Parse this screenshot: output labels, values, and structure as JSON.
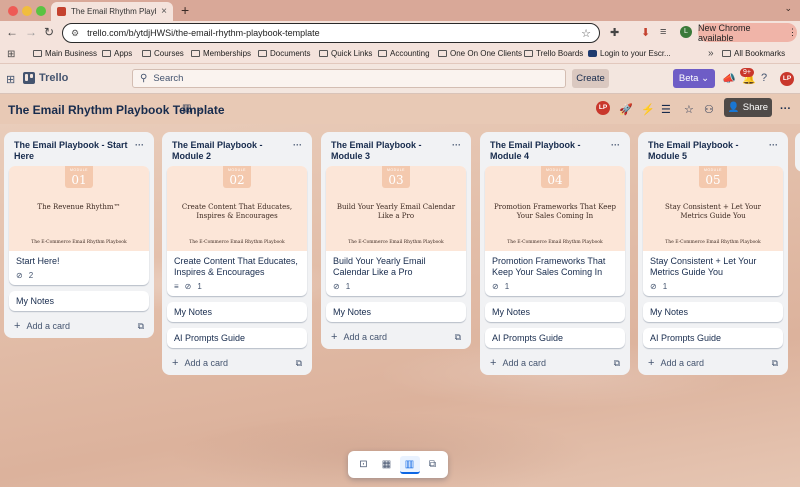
{
  "browser": {
    "tab_title": "The Email Rhythm Playbook T",
    "tab_close": "×",
    "new_tab": "+",
    "url": "trello.com/b/ytdjHWSi/the-email-rhythm-playbook-template",
    "new_chrome": "New Chrome available",
    "new_chrome_more": "⋮",
    "profile_initial": "L",
    "bookmarks": [
      "Main Business",
      "Apps",
      "Courses",
      "Memberships",
      "Documents",
      "Quick Links",
      "Accounting",
      "One On One Clients",
      "Trello Boards",
      "Login to your Escr..."
    ],
    "all_bookmarks": "All Bookmarks",
    "more_bookmarks": "»"
  },
  "header": {
    "brand": "Trello",
    "search_placeholder": "Search",
    "create_label": "Create",
    "beta_label": "Beta ⌄",
    "notification_count": "9+",
    "avatar_initials": "LP"
  },
  "board": {
    "title": "The Email Rhythm Playbook Template",
    "share_label": "Share",
    "avatar_initials": "LP",
    "more": "···"
  },
  "lists": [
    {
      "title": "The Email Playbook - Start Here",
      "menu": "···",
      "cover": {
        "module": "MODULE",
        "number": "01",
        "title": "The Revenue Rhythm™",
        "footer": "The E-Commerce Email Rhythm Playbook"
      },
      "card_text": "Start Here!",
      "badges": {
        "desc": "",
        "attachments": "2"
      },
      "extra_cards": [
        "My Notes"
      ],
      "add_card": "Add a card"
    },
    {
      "title": "The Email Playbook - Module 2",
      "menu": "···",
      "cover": {
        "module": "MODULE",
        "number": "02",
        "title": "Create Content That Educates, Inspires & Encourages",
        "footer": "The E-Commerce Email Rhythm Playbook"
      },
      "card_text": "Create Content That Educates, Inspires & Encourages",
      "badges": {
        "desc": "≡",
        "attachments": "1"
      },
      "extra_cards": [
        "My Notes",
        "AI Prompts Guide"
      ],
      "add_card": "Add a card"
    },
    {
      "title": "The Email Playbook - Module 3",
      "menu": "···",
      "cover": {
        "module": "MODULE",
        "number": "03",
        "title": "Build Your Yearly Email Calendar Like a Pro",
        "footer": "The E-Commerce Email Rhythm Playbook"
      },
      "card_text": "Build Your Yearly Email Calendar Like a Pro",
      "badges": {
        "desc": "",
        "attachments": "1"
      },
      "extra_cards": [
        "My Notes"
      ],
      "add_card": "Add a card"
    },
    {
      "title": "The Email Playbook - Module 4",
      "menu": "···",
      "cover": {
        "module": "MODULE",
        "number": "04",
        "title": "Promotion Frameworks That Keep Your Sales Coming In",
        "footer": "The E-Commerce Email Rhythm Playbook"
      },
      "card_text": "Promotion Frameworks That Keep Your Sales Coming In",
      "badges": {
        "desc": "",
        "attachments": "1"
      },
      "extra_cards": [
        "My Notes",
        "AI Prompts Guide"
      ],
      "add_card": "Add a card"
    },
    {
      "title": "The Email Playbook - Module 5",
      "menu": "···",
      "cover": {
        "module": "MODULE",
        "number": "05",
        "title": "Stay Consistent + Let Your Metrics Guide You",
        "footer": "The E-Commerce Email Rhythm Playbook"
      },
      "card_text": "Stay Consistent + Let Your Metrics Guide You",
      "badges": {
        "desc": "",
        "attachments": "1"
      },
      "extra_cards": [
        "My Notes",
        "AI Prompts Guide"
      ],
      "add_card": "Add a card"
    }
  ],
  "icons": {
    "attachment": "⊘",
    "add": "+",
    "template": "⧉"
  }
}
